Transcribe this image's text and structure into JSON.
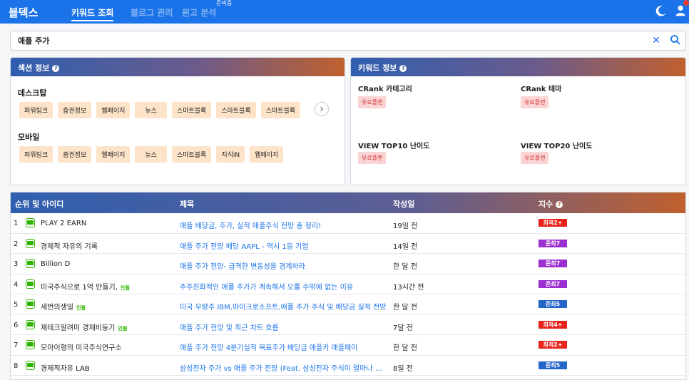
{
  "app": {
    "logo": "블덱스",
    "nav": [
      "키워드 조회",
      "블로그 관리",
      "원고 분석"
    ],
    "beta_label": "준비중"
  },
  "search": {
    "value": "애플 주가"
  },
  "section_panel": {
    "title": "섹션 정보",
    "desktop_label": "데스크탑",
    "desktop_tags": [
      "파워링크",
      "증권정보",
      "웹페이지",
      "뉴스",
      "스마트블록",
      "스마트블록",
      "스마트블록"
    ],
    "mobile_label": "모바일",
    "mobile_tags": [
      "파워링크",
      "증권정보",
      "웹페이지",
      "뉴스",
      "스마트블록",
      "지식iN",
      "웹페이지"
    ]
  },
  "keyword_panel": {
    "title": "키워드 정보",
    "items": [
      {
        "label": "CRank 카테고리",
        "badge": "유료플랜"
      },
      {
        "label": "CRank 테마",
        "badge": "유료플랜"
      },
      {
        "label": "VIEW TOP10 난이도",
        "badge": "유료플랜"
      },
      {
        "label": "VIEW TOP20 난이도",
        "badge": "유료플랜"
      }
    ]
  },
  "table": {
    "headers": [
      "순위 및 아이디",
      "제목",
      "작성일",
      "지수"
    ],
    "influencer_label": "인플",
    "rows": [
      {
        "rank": "1",
        "name": "PLAY 2 EARN",
        "influencer": false,
        "title": "애플 배당금, 주가, 실적 애플주식 전망 총 정리!",
        "date": "19일 전",
        "index": "최적2+",
        "color": "red"
      },
      {
        "rank": "2",
        "name": "경제적 자유의 기록",
        "influencer": false,
        "title": "애플 주가 전망 배당 AAPL - 역시 1등 기업",
        "date": "14일 전",
        "index": "준최7",
        "color": "purple"
      },
      {
        "rank": "3",
        "name": "Billion D",
        "influencer": false,
        "title": "애플 주가 전망- 급격한 변동성을 경계하라",
        "date": "한 달 전",
        "index": "준최7",
        "color": "purple"
      },
      {
        "rank": "4",
        "name": "미국주식으로 1억 만들기,",
        "influencer": true,
        "title": "주주친화적인 애플 주가가 계속해서 오를 수밖에 없는 이유",
        "date": "13시간 전",
        "index": "준최7",
        "color": "purple"
      },
      {
        "rank": "5",
        "name": "세번의생일",
        "influencer": true,
        "title": "미국 우량주 IBM,마이크로소프트,애플 주가 주식 및 배당금 실적 전망",
        "date": "한 달 전",
        "index": "준최5",
        "color": "blue"
      },
      {
        "rank": "6",
        "name": "재테크알려미 경제비둥기",
        "influencer": true,
        "title": "애플 주가 전망 및 최근 차트 흐름",
        "date": "7달 전",
        "index": "최적4+",
        "color": "red"
      },
      {
        "rank": "7",
        "name": "모아이형의 미국주식연구소",
        "influencer": false,
        "title": "애플 주가 전망 4분기실적 목표주가 배당금 애플카 애플페이",
        "date": "한 달 전",
        "index": "최적2+",
        "color": "red"
      },
      {
        "rank": "8",
        "name": "경제적자유 LAB",
        "influencer": false,
        "title": "삼성전자 주가 vs 애플 주가 전망 (Feat. 삼성전자 주식이 얼마나 저평가…",
        "date": "8일 전",
        "index": "준최5",
        "color": "blue"
      }
    ]
  },
  "colors": {
    "primary": "#1a73e8",
    "red": "#e8231c",
    "purple": "#9b2fcf",
    "blue": "#2465c8",
    "tag": "#fde3c8"
  }
}
